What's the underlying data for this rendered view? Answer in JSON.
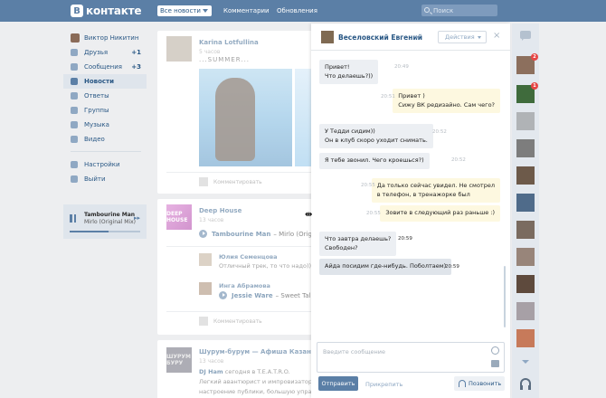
{
  "topbar": {
    "logo_letter": "В",
    "logo_text": "контакте",
    "news_dropdown": "Все новости",
    "comments_link": "Комментарии",
    "updates_link": "Обновления",
    "search_placeholder": "Поиск"
  },
  "sidebar": {
    "items": [
      {
        "label": "Виктор Никитин",
        "icon": "avatar",
        "count": ""
      },
      {
        "label": "Друзья",
        "icon": "friends-icon",
        "count": "+1"
      },
      {
        "label": "Сообщения",
        "icon": "messages-icon",
        "count": "+3"
      },
      {
        "label": "Новости",
        "icon": "news-icon",
        "count": "",
        "active": true
      },
      {
        "label": "Ответы",
        "icon": "replies-icon",
        "count": ""
      },
      {
        "label": "Группы",
        "icon": "groups-icon",
        "count": ""
      },
      {
        "label": "Музыка",
        "icon": "music-icon",
        "count": ""
      },
      {
        "label": "Видео",
        "icon": "video-icon",
        "count": ""
      },
      {
        "label": "Настройки",
        "icon": "gear-icon",
        "count": ""
      },
      {
        "label": "Выйти",
        "icon": "logout-icon",
        "count": ""
      }
    ]
  },
  "player": {
    "title": "Tambourine Man",
    "artist": "Mirlo (Original Mix)",
    "progress": 0.55
  },
  "feed": {
    "post1": {
      "author": "Karina Lotfullina",
      "time": "5 часов",
      "text": "...SUMMER...",
      "comment_label": "Комментировать"
    },
    "post2": {
      "author": "Deep House",
      "cover": "DEEP HOUSE",
      "time": "13 часов",
      "track_artist": "Tambourine Man",
      "track_title": "– Mirlo (Original Mix)",
      "replies": [
        {
          "name": "Юлия Семенцова",
          "text": "Отличный трек, то что надо))"
        },
        {
          "name": "Инга Абрамова",
          "track_artist": "Jessie Ware",
          "track_title": "– Sweet Talk"
        }
      ],
      "comment_label": "Комментировать"
    },
    "post3": {
      "author": "Шурум-бурум — Афиша Казани",
      "cover": "ШУРУМ БУРУ",
      "time": "13 часов",
      "line1_name": "DJ Ham",
      "line1_rest": "сегодня в T.E.A.T.R.O.",
      "line2": "Легкий авантюрист и импровизатор, DJ",
      "line3": "настроение публики, большую управленческую"
    }
  },
  "chat": {
    "contact_name": "Веселовский Евгений",
    "actions_label": "Действия",
    "close_glyph": "×",
    "messages": [
      {
        "dir": "in",
        "lines": [
          "Привет!",
          "Что делаешь?))"
        ],
        "time": "20:49"
      },
      {
        "dir": "out",
        "lines": [
          "Привет )",
          "Сижу ВК редизайно. Сам чего?"
        ],
        "time": "20:51"
      },
      {
        "dir": "in",
        "lines": [
          "У Тедди сидим))",
          "Он в клуб скоро уходит снимать."
        ],
        "time": "20:52"
      },
      {
        "dir": "in",
        "lines": [
          "Я тебе звонил. Чего кроешься?)"
        ],
        "time": "20:52"
      },
      {
        "dir": "out",
        "lines": [
          "Да только сейчас увидел. Не смотрел",
          "в телефон, в тренажорке был"
        ],
        "time": "20:55"
      },
      {
        "dir": "out",
        "lines": [
          "Зовите в следующий раз раньше :)"
        ],
        "time": "20:55"
      },
      {
        "dir": "in",
        "lines": [
          "Что завтра делаешь?",
          "Свободен?"
        ],
        "time": "20:59"
      },
      {
        "dir": "in",
        "lines": [
          "Айда посидим где-нибудь. Поболтаем)"
        ],
        "time": "20:59"
      }
    ],
    "input_placeholder": "Введите сообщение",
    "send_label": "Отправить",
    "attach_label": "Прикрепить",
    "call_label": "Позвонить"
  },
  "rail": {
    "badges": [
      "2",
      "1"
    ]
  }
}
